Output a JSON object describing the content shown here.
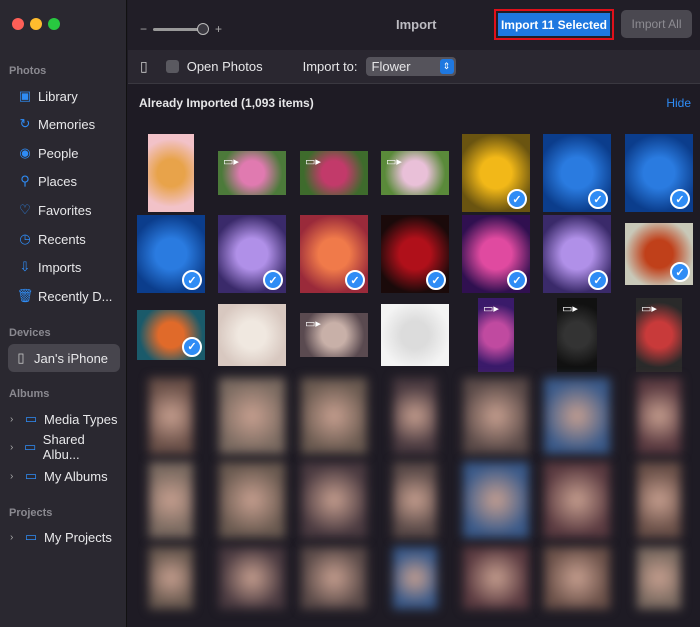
{
  "sidebar": {
    "sections": {
      "photos": "Photos",
      "devices": "Devices",
      "albums": "Albums",
      "projects": "Projects"
    },
    "photos": [
      {
        "label": "Library",
        "icon": "library-icon"
      },
      {
        "label": "Memories",
        "icon": "memories-icon"
      },
      {
        "label": "People",
        "icon": "people-icon"
      },
      {
        "label": "Places",
        "icon": "places-icon"
      },
      {
        "label": "Favorites",
        "icon": "heart-icon"
      },
      {
        "label": "Recents",
        "icon": "clock-icon"
      },
      {
        "label": "Imports",
        "icon": "imports-icon"
      },
      {
        "label": "Recently D...",
        "icon": "trash-icon"
      }
    ],
    "device": "Jan's iPhone",
    "albums": [
      "Media Types",
      "Shared Albu...",
      "My Albums"
    ],
    "projects": [
      "My Projects"
    ]
  },
  "toolbar": {
    "title": "Import",
    "import_selected": "Import 11 Selected",
    "import_all": "Import All",
    "zoom_minus": "−",
    "zoom_plus": "+"
  },
  "options": {
    "open_photos": "Open Photos",
    "import_to_label": "Import to:",
    "import_to_value": "Flower"
  },
  "section": {
    "title": "Already Imported (1,093 items)",
    "hide": "Hide"
  },
  "colors": {
    "accent": "#2f8cf5",
    "highlight": "#e0101a"
  }
}
